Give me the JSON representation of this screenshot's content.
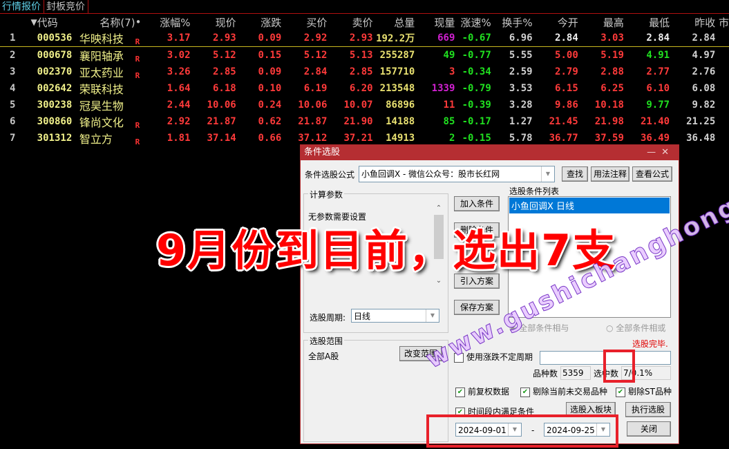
{
  "tabs": [
    {
      "label": "行情报价",
      "active": true
    },
    {
      "label": "封板竞价",
      "active": false
    }
  ],
  "table": {
    "headers": {
      "sort": "▼",
      "code": "代码",
      "name": "名称(7)",
      "dot": "•",
      "pct": "涨幅%",
      "price": "现价",
      "chg": "涨跌",
      "bid": "买价",
      "ask": "卖价",
      "vol": "总量",
      "cur": "现量",
      "speed": "涨速%",
      "turnover": "换手%",
      "open": "今开",
      "high": "最高",
      "low": "最低",
      "prev": "昨收",
      "extra": "市"
    },
    "rows": [
      {
        "idx": "1",
        "code": "000536",
        "name": "华映科技",
        "r": "R",
        "pct": "3.17",
        "price": "2.93",
        "chg": "0.09",
        "bid": "2.92",
        "ask": "2.93",
        "vol": "192.2万",
        "cur": "669",
        "speed": "-0.67",
        "turnover": "6.96",
        "open": "2.84",
        "high": "3.03",
        "low": "2.84",
        "prev": "2.84"
      },
      {
        "idx": "2",
        "code": "000678",
        "name": "襄阳轴承",
        "r": "R",
        "pct": "3.02",
        "price": "5.12",
        "chg": "0.15",
        "bid": "5.12",
        "ask": "5.13",
        "vol": "255287",
        "cur": "49",
        "speed": "-0.77",
        "turnover": "5.55",
        "open": "5.00",
        "high": "5.19",
        "low": "4.91",
        "prev": "4.97"
      },
      {
        "idx": "3",
        "code": "002370",
        "name": "亚太药业",
        "r": "R",
        "pct": "3.26",
        "price": "2.85",
        "chg": "0.09",
        "bid": "2.84",
        "ask": "2.85",
        "vol": "157710",
        "cur": "3",
        "speed": "-0.34",
        "turnover": "2.59",
        "open": "2.79",
        "high": "2.88",
        "low": "2.77",
        "prev": "2.76"
      },
      {
        "idx": "4",
        "code": "002642",
        "name": "荣联科技",
        "r": "",
        "pct": "1.64",
        "price": "6.18",
        "chg": "0.10",
        "bid": "6.19",
        "ask": "6.20",
        "vol": "213548",
        "cur": "1339",
        "speed": "-0.79",
        "turnover": "3.53",
        "open": "6.15",
        "high": "6.25",
        "low": "6.10",
        "prev": "6.08"
      },
      {
        "idx": "5",
        "code": "300238",
        "name": "冠昊生物",
        "r": "",
        "pct": "2.44",
        "price": "10.06",
        "chg": "0.24",
        "bid": "10.06",
        "ask": "10.07",
        "vol": "86896",
        "cur": "11",
        "speed": "-0.39",
        "turnover": "3.28",
        "open": "9.86",
        "high": "10.18",
        "low": "9.77",
        "prev": "9.82"
      },
      {
        "idx": "6",
        "code": "300860",
        "name": "锋尚文化",
        "r": "R",
        "pct": "2.92",
        "price": "21.87",
        "chg": "0.62",
        "bid": "21.87",
        "ask": "21.90",
        "vol": "14188",
        "cur": "85",
        "speed": "-0.17",
        "turnover": "1.27",
        "open": "21.45",
        "high": "21.98",
        "low": "21.40",
        "prev": "21.25"
      },
      {
        "idx": "7",
        "code": "301312",
        "name": "智立方",
        "r": "R",
        "pct": "1.81",
        "price": "37.14",
        "chg": "0.66",
        "bid": "37.12",
        "ask": "37.21",
        "vol": "14913",
        "cur": "2",
        "speed": "-0.15",
        "turnover": "5.78",
        "open": "36.77",
        "high": "37.59",
        "low": "36.49",
        "prev": "36.48"
      }
    ]
  },
  "dialog": {
    "title": "条件选股",
    "formula_label": "条件选股公式",
    "formula_value": "小鱼回调X  -  微信公众号：股市长红网",
    "btn_find": "查找",
    "btn_usage": "用法注释",
    "btn_view": "查看公式",
    "params_group": "计算参数",
    "params_text": "无参数需要设置",
    "btn_add": "加入条件",
    "btn_remove": "删除条件",
    "btn_import": "引入方案",
    "btn_save": "保存方案",
    "cond_list_label": "选股条件列表",
    "cond_list": [
      "小鱼回调X  日线"
    ],
    "period_label": "选股周期:",
    "period_value": "日线",
    "radio_and": "全部条件相与",
    "radio_or": "全部条件相或",
    "status": "选股完毕.",
    "scope_group": "选股范围",
    "scope_value": "全部A股",
    "btn_change_scope": "改变范围",
    "use_period_label": "使用涨跌不定周期",
    "count_label": "品种数",
    "count_value": "5359",
    "selected_label": "选中数",
    "selected_value": "7/0.1%",
    "chk_fq": "前复权数据",
    "chk_exclude_nontrade": "剔除当前未交易品种",
    "chk_exclude_st": "剔除ST品种",
    "chk_period": "时间段内满足条件",
    "btn_to_block": "选股入板块",
    "btn_run": "执行选股",
    "btn_close": "关闭",
    "date_from": "2024-09-01",
    "date_sep": "-",
    "date_to": "2024-09-25"
  },
  "overlay": {
    "caption": "9月份到目前，选出7支",
    "watermark": "www.gushichanghong.com"
  },
  "colors": {
    "up": "#ff3a3a",
    "down": "#20e020",
    "code": "#f0f08a",
    "title_bar": "#b52e32",
    "highlight": "#0078d7",
    "annotation": "#e8202a"
  }
}
